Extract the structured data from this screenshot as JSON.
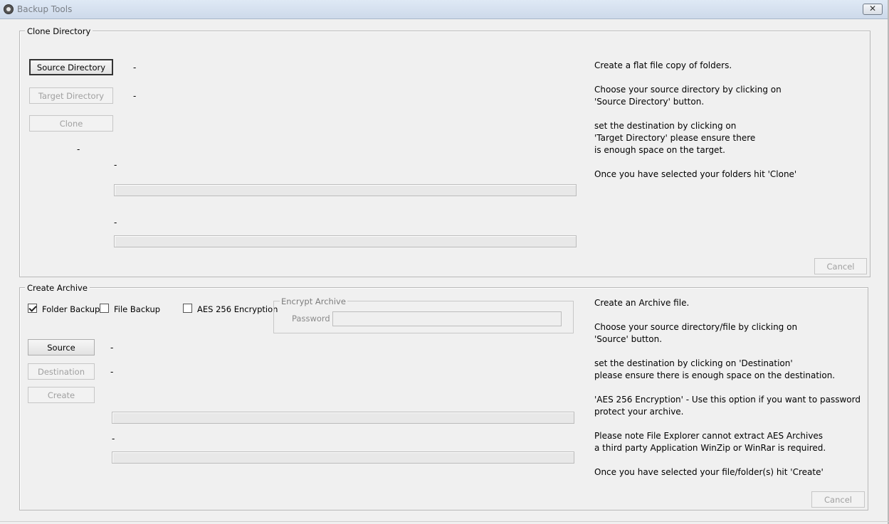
{
  "window": {
    "title": "Backup Tools",
    "close_glyph": "✕",
    "icon": "app-disc-icon"
  },
  "clone": {
    "group_label": "Clone Directory",
    "source_button": "Source Directory",
    "target_button": "Target Directory",
    "clone_button": "Clone",
    "source_value": "-",
    "target_value": "-",
    "status_1": "-",
    "status_2": "-",
    "status_3": "-",
    "cancel_button": "Cancel",
    "info": [
      [
        "Create a flat file copy of folders."
      ],
      [
        "Choose your source directory by clicking on",
        "'Source Directory' button."
      ],
      [
        "set the destination by clicking on",
        "'Target Directory' please ensure there",
        "is enough space on the target."
      ],
      [
        "Once you have selected your folders hit 'Clone'"
      ]
    ]
  },
  "archive": {
    "group_label": "Create Archive",
    "folder_backup_label": "Folder Backup",
    "folder_backup_checked": true,
    "file_backup_label": "File Backup",
    "file_backup_checked": false,
    "aes_label": "AES 256 Encryption",
    "aes_checked": false,
    "encrypt_group_label": "Encrypt Archive",
    "password_label": "Password",
    "password_value": "",
    "source_button": "Source",
    "destination_button": "Destination",
    "create_button": "Create",
    "source_value": "-",
    "destination_value": "-",
    "status_1": "-",
    "cancel_button": "Cancel",
    "info": [
      [
        "Create an Archive file."
      ],
      [
        "Choose your source directory/file by clicking on",
        "'Source' button."
      ],
      [
        "set the destination by clicking on 'Destination'",
        "please ensure there is enough space on the destination."
      ],
      [
        "'AES 256 Encryption' - Use this option if you want to password",
        "protect your archive."
      ],
      [
        "Please note File Explorer cannot extract AES Archives",
        "a third party Application WinZip or WinRar is required."
      ],
      [
        "Once you have selected your file/folder(s) hit 'Create'"
      ]
    ]
  }
}
